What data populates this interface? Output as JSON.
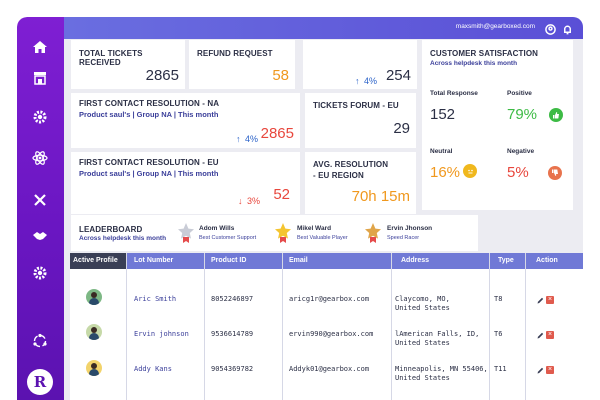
{
  "topbar": {
    "email": "maxsmith@gearboxed.com"
  },
  "tickets_received": {
    "title": "TOTAL TICKETS RECEIVED",
    "value": "2865"
  },
  "refund": {
    "title": "REFUND REQUEST",
    "value": "58"
  },
  "third": {
    "pct": "4%",
    "value": "254"
  },
  "fcr_na": {
    "title": "FIRST CONTACT RESOLUTION - NA",
    "sub": "Product saul's | Group NA | This month",
    "pct": "4%",
    "value": "2865"
  },
  "forums": {
    "title": "TICKETS FORUM - EU",
    "value": "29"
  },
  "fcr_eu": {
    "title": "FIRST CONTACT RESOLUTION - EU",
    "sub": "Product saul's | Group NA | This month",
    "pct": "3%",
    "value": "52"
  },
  "avg_res": {
    "title_line1": "AVG. RESOLUTION",
    "title_line2": "- EU REGION",
    "value": "70h 15m"
  },
  "satisfaction": {
    "title": "CUSTOMER SATISFACTION",
    "sub": "Across helpdesk this month",
    "total_label": "Total Response",
    "total_value": "152",
    "positive_label": "Positive",
    "positive_value": "79%",
    "neutral_label": "Neutral",
    "neutral_value": "16%",
    "negative_label": "Negative",
    "negative_value": "5%"
  },
  "leaderboard": {
    "title": "LEADERBOARD",
    "sub": "Across helpdesk this month",
    "people": [
      {
        "name": "Adom Wills",
        "role": "Best Customer Support"
      },
      {
        "name": "Mikel Ward",
        "role": "Best Valuable Player"
      },
      {
        "name": "Ervin Jhonson",
        "role": "Speed Racer"
      }
    ]
  },
  "table": {
    "headers": [
      "Active Profile",
      "Lot Number",
      "Product  ID",
      "Email",
      "Address",
      "Type",
      "Action"
    ],
    "rows": [
      {
        "name": "Aric Smith",
        "product_id": "8052246897",
        "email": "aricg1r@gearbox.com",
        "addr1": "Claycomo, MO,",
        "addr2": "United States",
        "type": "T8"
      },
      {
        "name": "Ervin johnson",
        "product_id": "9536614789",
        "email": "ervin990@gearbox.com",
        "addr1": "lAmerican Falls, ID,",
        "addr2": "United States",
        "type": "T6"
      },
      {
        "name": "Addy Kans",
        "product_id": "9054369782",
        "email": "Addyk01@gearbox.com",
        "addr1": "Minneapolis, MN 55406,",
        "addr2": "United States",
        "type": "T11"
      }
    ]
  },
  "colors": {
    "sidebar": "#6a16c2",
    "topbar": "#5a4fd6",
    "table_header": "#7079d6",
    "orange": "#f0981e",
    "red": "#e8473d",
    "green": "#3dbb45"
  }
}
